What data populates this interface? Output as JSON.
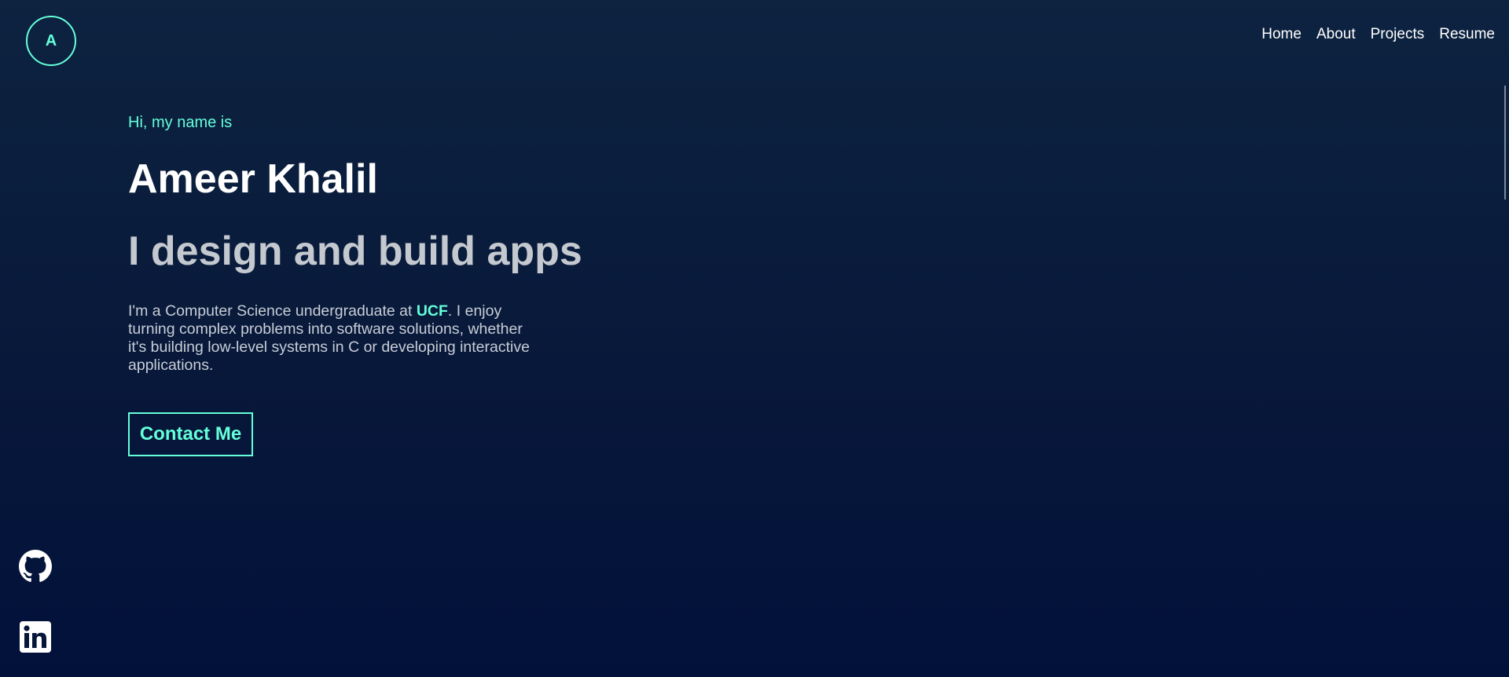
{
  "logo": {
    "letter": "A"
  },
  "nav": {
    "items": [
      {
        "label": "Home"
      },
      {
        "label": "About"
      },
      {
        "label": "Projects"
      },
      {
        "label": "Resume"
      }
    ]
  },
  "hero": {
    "greeting": "Hi, my name is",
    "name": "Ameer Khalil",
    "tagline": "I design and build apps",
    "bio": {
      "before": "I'm a Computer Science undergraduate at ",
      "highlight": "UCF",
      "after": ". I enjoy turning complex problems into software solutions, whether it's building low-level systems in C or developing interactive applications."
    },
    "cta_label": "Contact Me"
  },
  "social": {
    "github_icon": "github-icon",
    "linkedin_icon": "linkedin-icon"
  },
  "colors": {
    "accent": "#64ffda",
    "background_top": "#0d2340",
    "background_bottom": "#02113a",
    "text_primary": "#ffffff",
    "text_muted": "#c4c8cf"
  }
}
